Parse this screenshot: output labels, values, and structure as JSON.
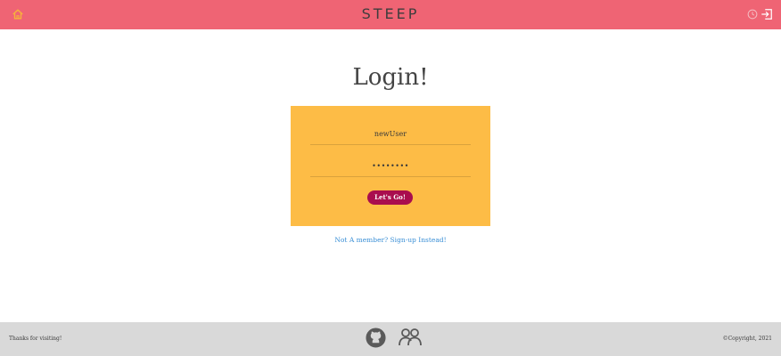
{
  "header": {
    "brand": "STEEP",
    "home_icon": "home-icon",
    "clock_icon": "clock-icon",
    "logout_icon": "logout-icon"
  },
  "main": {
    "title": "Login!",
    "username_value": "newUser",
    "password_value": "••••••••",
    "submit_label": "Let's Go!",
    "signup_link": "Not A member? Sign-up Instead!"
  },
  "footer": {
    "thanks": "Thanks for visiting!",
    "copyright": "©Copyright, 2021",
    "github_icon": "github-icon",
    "team_icon": "team-icon"
  },
  "colors": {
    "header_bg": "#ef6474",
    "card_bg": "#fdbc46",
    "button_bg": "#a90d4e",
    "link": "#3a8fd6",
    "footer_bg": "#d9d9d9"
  }
}
